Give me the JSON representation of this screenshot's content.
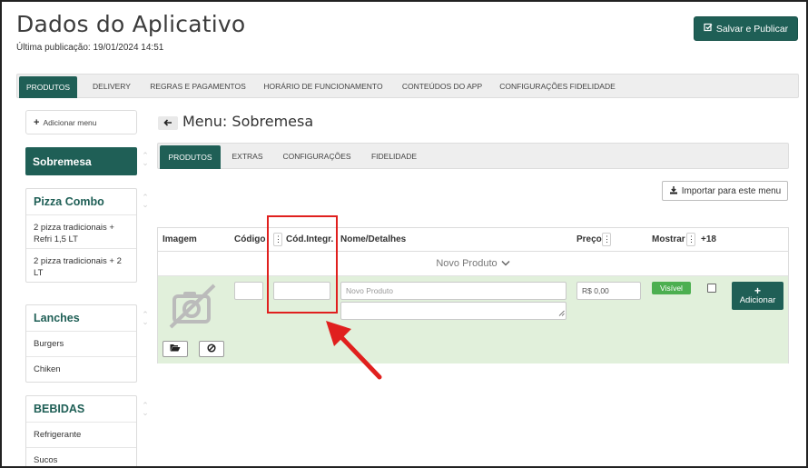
{
  "header": {
    "title": "Dados do Aplicativo",
    "last_publication": "Última publicação: 19/01/2024 14:51",
    "publish_button": "Salvar e Publicar"
  },
  "main_tabs": [
    {
      "label": "PRODUTOS",
      "active": true
    },
    {
      "label": "DELIVERY"
    },
    {
      "label": "REGRAS E PAGAMENTOS"
    },
    {
      "label": "HORÁRIO DE FUNCIONAMENTO"
    },
    {
      "label": "CONTEÚDOS DO APP"
    },
    {
      "label": "CONFIGURAÇÕES FIDELIDADE"
    }
  ],
  "sidebar": {
    "add_menu_label": "Adicionar menu",
    "active_menu": "Sobremesa",
    "groups": [
      {
        "title": "Pizza Combo",
        "items": [
          "2 pizza tradicionais + Refri 1,5 LT",
          "2 pizza tradicionais + 2 LT"
        ]
      },
      {
        "title": "Lanches",
        "items": [
          "Burgers",
          "Chiken"
        ]
      },
      {
        "title": "BEBIDAS",
        "items": [
          "Refrigerante",
          "Sucos"
        ]
      }
    ]
  },
  "menu": {
    "title": "Menu: Sobremesa",
    "sub_tabs": [
      {
        "label": "PRODUTOS",
        "active": true
      },
      {
        "label": "EXTRAS"
      },
      {
        "label": "CONFIGURAÇÕES"
      },
      {
        "label": "FIDELIDADE"
      }
    ],
    "import_button": "Importar para este menu"
  },
  "product_table": {
    "columns": {
      "image": "Imagem",
      "code": "Código",
      "integration_code": "Cód.Integr.",
      "name_details": "Nome/Detalhes",
      "price": "Preço",
      "show": "Mostrar",
      "plus18": "+18"
    },
    "new_product_toggle": "Novo Produto",
    "new_row": {
      "name_placeholder": "Novo Produto",
      "price_value": "R$ 0,00",
      "visibility_badge": "Visível",
      "add_button": "Adicionar",
      "show_checked": false
    }
  },
  "colors": {
    "primary": "#1f5f56",
    "row_highlight": "#e1f0db",
    "badge_green": "#4caf50",
    "annotation_red": "#e0201e"
  }
}
